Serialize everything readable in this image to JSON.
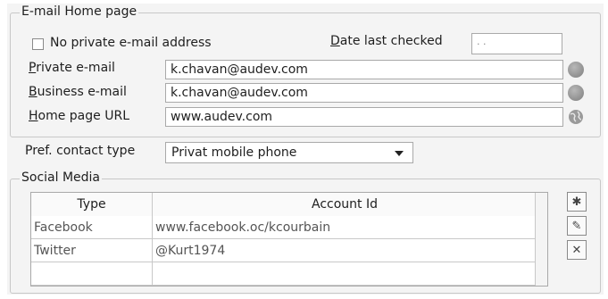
{
  "email_group": {
    "title": "E-mail  Home page",
    "no_private_label": "No private e-mail address",
    "no_private_checked": false,
    "date_last_checked_label": "Date last checked",
    "date_last_checked_value": ".  .",
    "private_email_label": "Private e-mail",
    "private_email_value": "k.chavan@audev.com",
    "business_email_label": "Business e-mail",
    "business_email_value": "k.chavan@audev.com",
    "home_page_label": "Home page URL",
    "home_page_value": "www.audev.com"
  },
  "contact": {
    "label": "Pref. contact type",
    "value": "Privat mobile phone"
  },
  "social": {
    "title": "Social Media",
    "columns": [
      "Type",
      "Account Id"
    ],
    "rows": [
      {
        "type": "Facebook",
        "account": "www.facebook.oc/kcourbain"
      },
      {
        "type": "Twitter",
        "account": "@Kurt1974"
      },
      {
        "type": "",
        "account": ""
      }
    ]
  },
  "icons": {
    "private_email": "mail-globe-icon",
    "business_email": "mail-globe-icon",
    "home_page": "globe-icon",
    "add_row": "new-row-icon",
    "edit_row": "edit-pencil-icon",
    "delete_row": "delete-x-icon"
  }
}
